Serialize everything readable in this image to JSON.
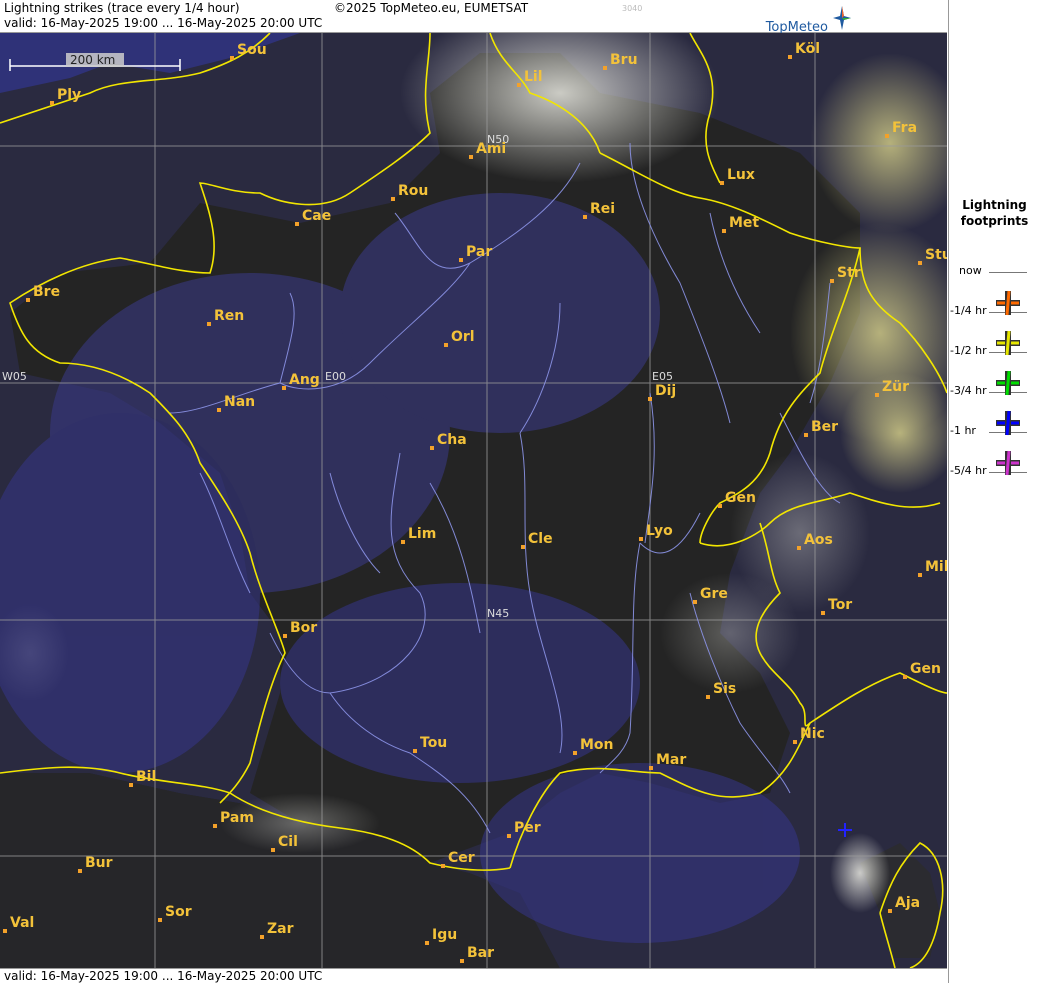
{
  "header": {
    "product": "Lightning strikes (trace every 1/4 hour)",
    "copyright": "©2025 TopMeteo.eu, EUMETSAT",
    "code": "3040",
    "valid_top": "valid:  16-May-2025 19:00 ... 16-May-2025 20:00 UTC",
    "logo_text": "TopMeteo"
  },
  "footer": {
    "valid_bottom": "valid:  16-May-2025 19:00 ... 16-May-2025 20:00 UTC"
  },
  "scale": {
    "label": "200 km"
  },
  "grid_labels": {
    "n50": "N50",
    "n45": "N45",
    "w05": "W05",
    "e00": "E00",
    "e05": "E05"
  },
  "cities": [
    {
      "name": "Sou"
    },
    {
      "name": "Ply"
    },
    {
      "name": "Lil"
    },
    {
      "name": "Bru"
    },
    {
      "name": "Köl"
    },
    {
      "name": "Ami"
    },
    {
      "name": "Fra"
    },
    {
      "name": "Rou"
    },
    {
      "name": "Cae"
    },
    {
      "name": "Rei"
    },
    {
      "name": "Lux"
    },
    {
      "name": "Met"
    },
    {
      "name": "Par"
    },
    {
      "name": "Stu"
    },
    {
      "name": "Str"
    },
    {
      "name": "Bre"
    },
    {
      "name": "Ren"
    },
    {
      "name": "Orl"
    },
    {
      "name": "Ang"
    },
    {
      "name": "Dij"
    },
    {
      "name": "Zür"
    },
    {
      "name": "Nan"
    },
    {
      "name": "Ber"
    },
    {
      "name": "Cha"
    },
    {
      "name": "Gen"
    },
    {
      "name": "Lim"
    },
    {
      "name": "Cle"
    },
    {
      "name": "Lyo"
    },
    {
      "name": "Aos"
    },
    {
      "name": "Mil"
    },
    {
      "name": "Gre"
    },
    {
      "name": "Tor"
    },
    {
      "name": "Bor"
    },
    {
      "name": "Gen"
    },
    {
      "name": "Sis"
    },
    {
      "name": "Nic"
    },
    {
      "name": "Tou"
    },
    {
      "name": "Mon"
    },
    {
      "name": "Mar"
    },
    {
      "name": "Bil"
    },
    {
      "name": "Pam"
    },
    {
      "name": "Cil"
    },
    {
      "name": "Per"
    },
    {
      "name": "Cer"
    },
    {
      "name": "Bur"
    },
    {
      "name": "Sor"
    },
    {
      "name": "Val"
    },
    {
      "name": "Zar"
    },
    {
      "name": "Igu"
    },
    {
      "name": "Bar"
    },
    {
      "name": "Aja"
    }
  ],
  "legend": {
    "title_line1": "Lightning",
    "title_line2": "footprints",
    "rows": [
      {
        "label": "now",
        "color": ""
      },
      {
        "label": "-1/4 hr",
        "color": "#ff6a00"
      },
      {
        "label": "-1/2 hr",
        "color": "#e6e600"
      },
      {
        "label": "-3/4 hr",
        "color": "#00dd00"
      },
      {
        "label": "-1 hr",
        "color": "#0000ff"
      },
      {
        "label": "-5/4 hr",
        "color": "#cc33cc"
      }
    ]
  },
  "strikes": [
    {
      "age": "-1 hr",
      "color": "#2222ff"
    }
  ]
}
